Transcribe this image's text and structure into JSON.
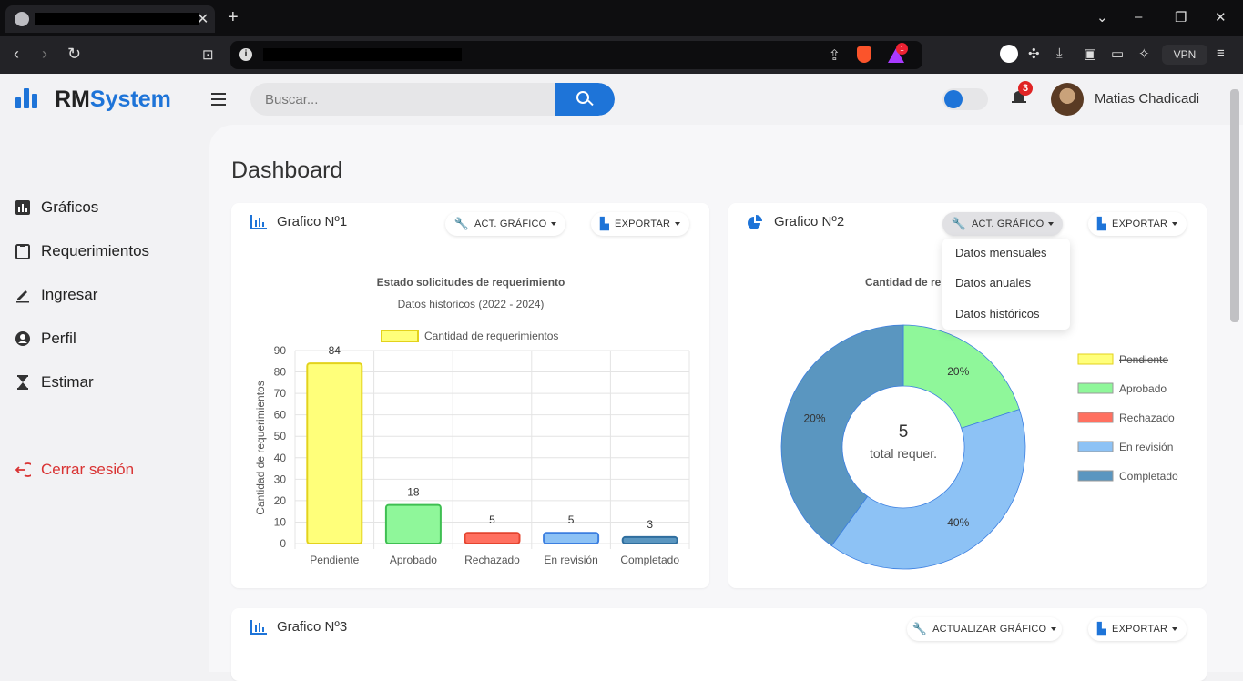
{
  "browser": {
    "tab_close": "✕",
    "new_tab": "+",
    "vpn_label": "VPN",
    "rewards_badge": "1"
  },
  "header": {
    "logo_part1": "RM",
    "logo_part2": "System",
    "search_placeholder": "Buscar...",
    "notifications_count": "3",
    "user_name": "Matias Chadicadi",
    "accent_color": "#1e74d8"
  },
  "sidebar": {
    "items": [
      {
        "label": "Gráficos",
        "icon": "bar-chart-icon"
      },
      {
        "label": "Requerimientos",
        "icon": "clipboard-icon"
      },
      {
        "label": "Ingresar",
        "icon": "pencil-icon"
      },
      {
        "label": "Perfil",
        "icon": "user-circle-icon"
      },
      {
        "label": "Estimar",
        "icon": "hourglass-icon"
      }
    ],
    "logout_label": "Cerrar sesión"
  },
  "page": {
    "title": "Dashboard"
  },
  "card1": {
    "title": "Grafico Nº1",
    "update_btn": "ACT. GRÁFICO",
    "export_btn": "EXPORTAR"
  },
  "card2": {
    "title": "Grafico Nº2",
    "update_btn": "ACT. GRÁFICO",
    "export_btn": "EXPORTAR",
    "dropdown": [
      "Datos mensuales",
      "Datos anuales",
      "Datos históricos"
    ],
    "center_value": "5",
    "center_label": "total requer."
  },
  "card3": {
    "title": "Grafico Nº3",
    "update_btn": "ACTUALIZAR GRÁFICO",
    "export_btn": "EXPORTAR"
  },
  "chart_data": [
    {
      "type": "bar",
      "title": "Estado solicitudes de requerimiento",
      "subtitle": "Datos historicos (2022 - 2024)",
      "ylabel": "Cantidad de requerimientos",
      "xlabel": "",
      "ylim": [
        0,
        90
      ],
      "yticks": [
        0,
        10,
        20,
        30,
        40,
        50,
        60,
        70,
        80,
        90
      ],
      "grid": true,
      "legend": "top",
      "legend_label": "Cantidad de requerimientos",
      "categories": [
        "Pendiente",
        "Aprobado",
        "Rechazado",
        "En revisión",
        "Completado"
      ],
      "values": [
        84,
        18,
        5,
        5,
        3
      ],
      "colors": [
        "#ffff7a",
        "#8ff79a",
        "#ff7060",
        "#8dc2f5",
        "#5a96c0"
      ],
      "borders": [
        "#e3d21c",
        "#3fbf52",
        "#e4442f",
        "#3c7fe0",
        "#2f6e9e"
      ]
    },
    {
      "type": "pie",
      "title": "Cantidad de re",
      "legend": "right",
      "categories": [
        "Pendiente",
        "Aprobado",
        "Rechazado",
        "En revisión",
        "Completado"
      ],
      "values": [
        0,
        1,
        0,
        2,
        2
      ],
      "percent_labels": [
        "20%",
        "40%",
        "20%"
      ],
      "hidden": [
        "Pendiente"
      ],
      "colors": [
        "#ffff7a",
        "#8ff79a",
        "#ff7060",
        "#8dc2f5",
        "#5a96c0"
      ]
    }
  ]
}
